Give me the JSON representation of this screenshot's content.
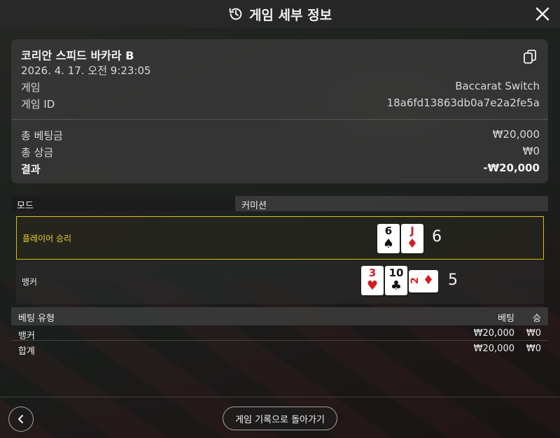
{
  "header": {
    "title": "게임 세부 정보",
    "icons": {
      "history": "history-icon",
      "close": "close-icon"
    }
  },
  "summary": {
    "game_name": "코리안 스피드 바카라 B",
    "datetime": "2026. 4. 17. 오전 9:23:05",
    "game_label": "게임",
    "game_value": "Baccarat Switch",
    "game_id_label": "게임 ID",
    "game_id_value": "18a6fd13863db0a7e2a2fe5a",
    "total_bet_label": "총 베팅금",
    "total_bet_value": "₩20,000",
    "total_win_label": "총 상금",
    "total_win_value": "₩0",
    "result_label": "결과",
    "result_value": "-₩20,000",
    "copy_icon": "copy-icon"
  },
  "mode_bar": {
    "mode_label": "모드",
    "commission_label": "커미션"
  },
  "hands": {
    "player": {
      "label": "플레이어 승리",
      "total": "6",
      "cards": [
        {
          "rank": "6",
          "suit": "♠",
          "color": "black"
        },
        {
          "rank": "J",
          "suit": "♦",
          "color": "red"
        }
      ]
    },
    "banker": {
      "label": "뱅커",
      "total": "5",
      "cards": [
        {
          "rank": "3",
          "suit": "♥",
          "color": "red"
        },
        {
          "rank": "10",
          "suit": "♣",
          "color": "black"
        },
        {
          "rank": "2",
          "suit": "♦",
          "color": "red"
        }
      ]
    }
  },
  "bets": {
    "headers": {
      "type": "베팅 유형",
      "bet": "베팅",
      "win": "승"
    },
    "rows": [
      {
        "type": "뱅커",
        "bet": "₩20,000",
        "win": "₩0"
      },
      {
        "type": "합계",
        "bet": "₩20,000",
        "win": "₩0"
      }
    ]
  },
  "footer": {
    "back_icon": "chevron-left-icon",
    "return_label": "게임 기록으로 돌아가기"
  },
  "colors": {
    "highlight": "#d7c11a",
    "card_red": "#d21c24",
    "card_black": "#111111"
  }
}
